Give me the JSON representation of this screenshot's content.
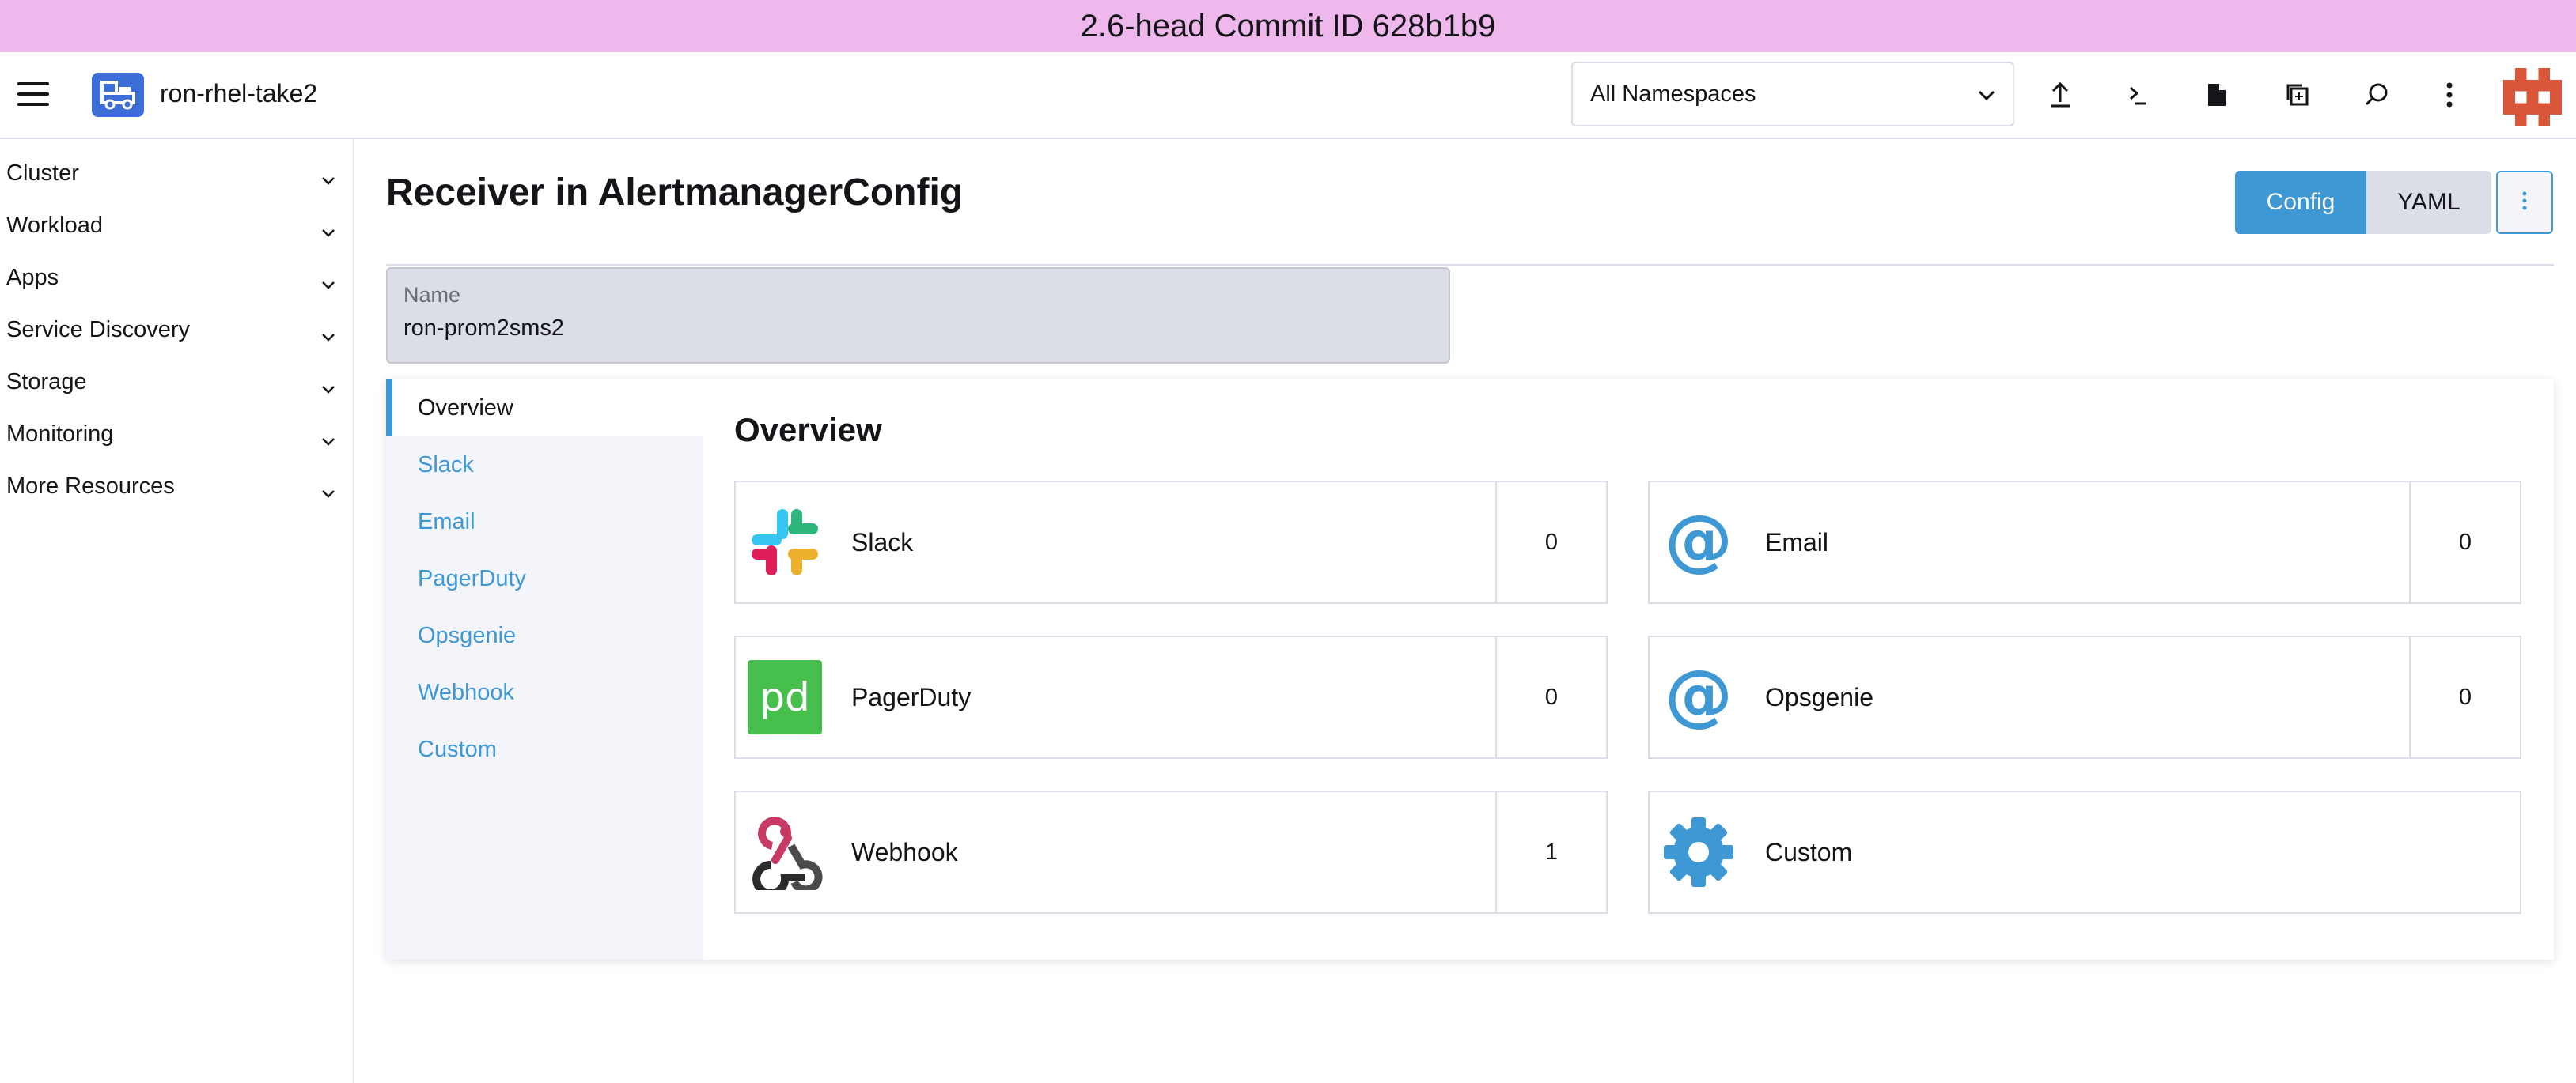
{
  "banner": {
    "text": "2.6-head Commit ID 628b1b9"
  },
  "header": {
    "cluster_name": "ron-rhel-take2",
    "namespace_select": "All Namespaces",
    "icons": [
      "upload-icon",
      "terminal-icon",
      "file-icon",
      "copy-config-icon",
      "search-icon",
      "more-vertical-icon"
    ]
  },
  "sidebar": {
    "items": [
      {
        "label": "Cluster"
      },
      {
        "label": "Workload"
      },
      {
        "label": "Apps"
      },
      {
        "label": "Service Discovery"
      },
      {
        "label": "Storage"
      },
      {
        "label": "Monitoring"
      },
      {
        "label": "More Resources"
      }
    ]
  },
  "main": {
    "title": "Receiver in AlertmanagerConfig",
    "buttons": {
      "config": "Config",
      "yaml": "YAML"
    },
    "name_field": {
      "label": "Name",
      "value": "ron-prom2sms2"
    },
    "tabs": [
      {
        "label": "Overview"
      },
      {
        "label": "Slack"
      },
      {
        "label": "Email"
      },
      {
        "label": "PagerDuty"
      },
      {
        "label": "Opsgenie"
      },
      {
        "label": "Webhook"
      },
      {
        "label": "Custom"
      }
    ],
    "overview": {
      "title": "Overview",
      "cards": [
        {
          "name": "Slack",
          "count": "0",
          "icon": "slack-icon"
        },
        {
          "name": "Email",
          "count": "0",
          "icon": "at-sign-icon"
        },
        {
          "name": "PagerDuty",
          "count": "0",
          "icon": "pagerduty-icon"
        },
        {
          "name": "Opsgenie",
          "count": "0",
          "icon": "at-sign-icon"
        },
        {
          "name": "Webhook",
          "count": "1",
          "icon": "webhook-icon"
        },
        {
          "name": "Custom",
          "icon": "gear-icon"
        }
      ]
    }
  },
  "colors": {
    "banner": "#eeb8ec",
    "accent": "#3d98d3",
    "logo": "#3d6ed8",
    "pagerduty": "#47bf4d"
  }
}
